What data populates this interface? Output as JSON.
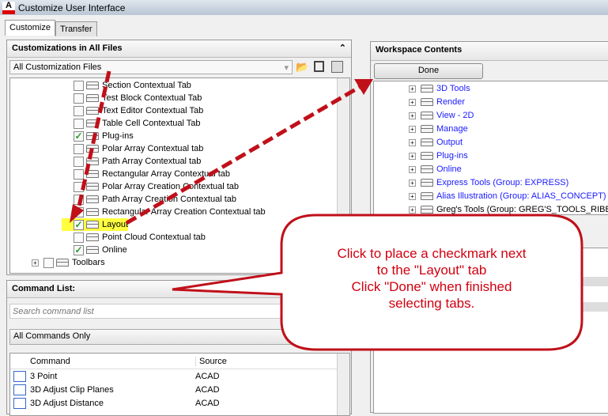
{
  "window": {
    "title": "Customize User Interface",
    "app_icon_letter": "A"
  },
  "tabs": [
    {
      "label": "Customize",
      "active": true
    },
    {
      "label": "Transfer",
      "active": false
    }
  ],
  "customizations": {
    "header": "Customizations in All Files",
    "file_select": "All Customization Files",
    "items": [
      {
        "label": "Section Contextual Tab",
        "checked": false
      },
      {
        "label": "Test Block Contextual Tab",
        "checked": false
      },
      {
        "label": "Text Editor Contextual Tab",
        "checked": false
      },
      {
        "label": "Table Cell Contextual Tab",
        "checked": false
      },
      {
        "label": "Plug-ins",
        "checked": true
      },
      {
        "label": "Polar Array  Contextual tab",
        "checked": false
      },
      {
        "label": "Path Array Contextual tab",
        "checked": false
      },
      {
        "label": "Rectangular Array Contextual tab",
        "checked": false
      },
      {
        "label": "Polar Array Creation Contextual tab",
        "checked": false
      },
      {
        "label": "Path Array Creation Contextual tab",
        "checked": false
      },
      {
        "label": "Rectangular Array Creation Contextual tab",
        "checked": false
      },
      {
        "label": "Layout",
        "checked": true,
        "highlighted": true
      },
      {
        "label": "Point Cloud Contextual tab",
        "checked": false
      },
      {
        "label": "Online",
        "checked": true
      }
    ],
    "toolbars_label": "Toolbars"
  },
  "command_list": {
    "header": "Command List:",
    "search_placeholder": "Search command list",
    "filter": "All Commands Only",
    "columns": [
      "Command",
      "Source"
    ],
    "rows": [
      {
        "command": "3 Point",
        "source": "ACAD"
      },
      {
        "command": "3D Adjust Clip Planes",
        "source": "ACAD"
      },
      {
        "command": "3D Adjust Distance",
        "source": "ACAD"
      }
    ]
  },
  "workspace": {
    "header": "Workspace Contents",
    "done_label": "Done",
    "items": [
      "3D Tools",
      "Render",
      "View - 2D",
      "Manage",
      "Output",
      "Plug-ins",
      "Online",
      "Express Tools (Group: EXPRESS)",
      "Alias Illustration (Group: ALIAS_CONCEPT)",
      "Greg's Tools (Group: GREG'S_TOOLS_RIBBON)"
    ]
  },
  "callout": {
    "line1": "Click to place a checkmark next",
    "line2": "to the \"Layout\" tab",
    "line3": "Click \"Done\" when finished",
    "line4": "selecting tabs.",
    "color": "#d00010"
  }
}
